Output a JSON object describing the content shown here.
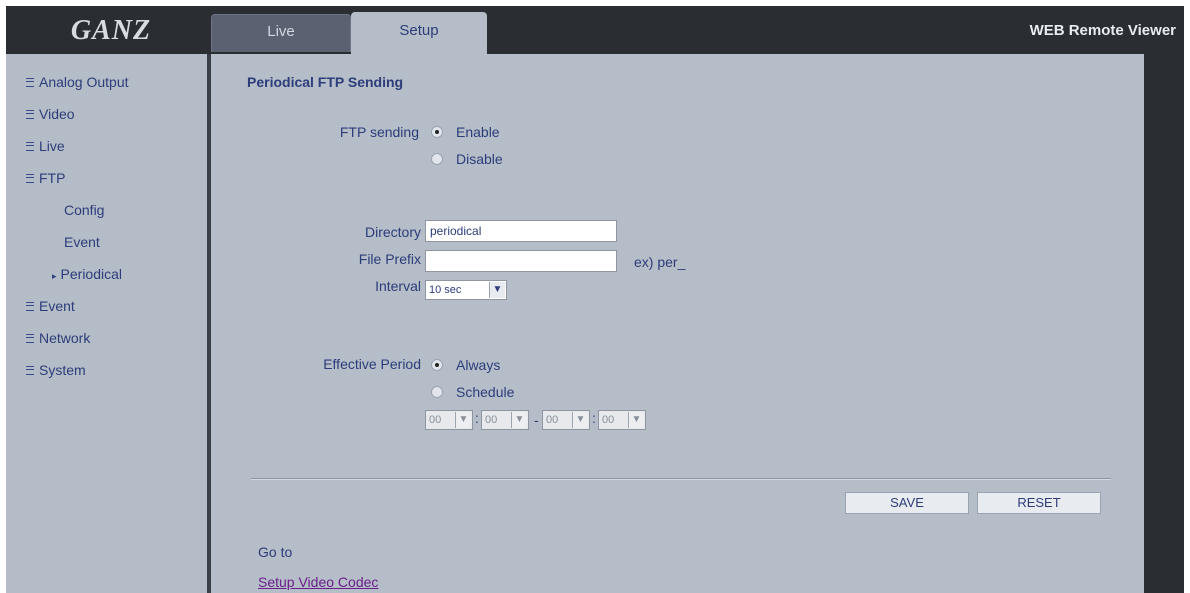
{
  "header": {
    "logo_text": "GANZ",
    "tabs": [
      {
        "label": "Live",
        "active": false
      },
      {
        "label": "Setup",
        "active": true
      }
    ],
    "app_title": "WEB Remote Viewer"
  },
  "sidebar": {
    "items": [
      {
        "label": "Analog Output"
      },
      {
        "label": "Video"
      },
      {
        "label": "Live"
      },
      {
        "label": "FTP"
      },
      {
        "label": "Config"
      },
      {
        "label": "Event"
      },
      {
        "label": "Periodical",
        "active": true
      },
      {
        "label": "Event"
      },
      {
        "label": "Network"
      },
      {
        "label": "System"
      }
    ],
    "active_marker": "▸"
  },
  "form": {
    "section_title": "Periodical FTP Sending",
    "ftp_sending": {
      "label": "FTP sending",
      "options": [
        "Enable",
        "Disable"
      ],
      "selected": "Enable"
    },
    "directory": {
      "label": "Directory",
      "value": "periodical"
    },
    "file_prefix": {
      "label": "File Prefix",
      "value": "",
      "example": "ex) per_"
    },
    "interval": {
      "label": "Interval",
      "value": "10 sec"
    },
    "effective_period": {
      "label": "Effective Period",
      "options": [
        "Always",
        "Schedule"
      ],
      "selected": "Always",
      "schedule": {
        "start_hour": "00",
        "start_min": "00",
        "end_hour": "00",
        "end_min": "00",
        "time_sep": ":",
        "range_sep": "-"
      }
    },
    "buttons": {
      "save": "SAVE",
      "reset": "RESET"
    }
  },
  "footer": {
    "goto_label": "Go to",
    "link_text": "Setup Video Codec"
  },
  "colors": {
    "frame": "#2a2d32",
    "panel": "#b5bdc8",
    "text": "#2c3d7a",
    "link": "#6a1f8a"
  }
}
